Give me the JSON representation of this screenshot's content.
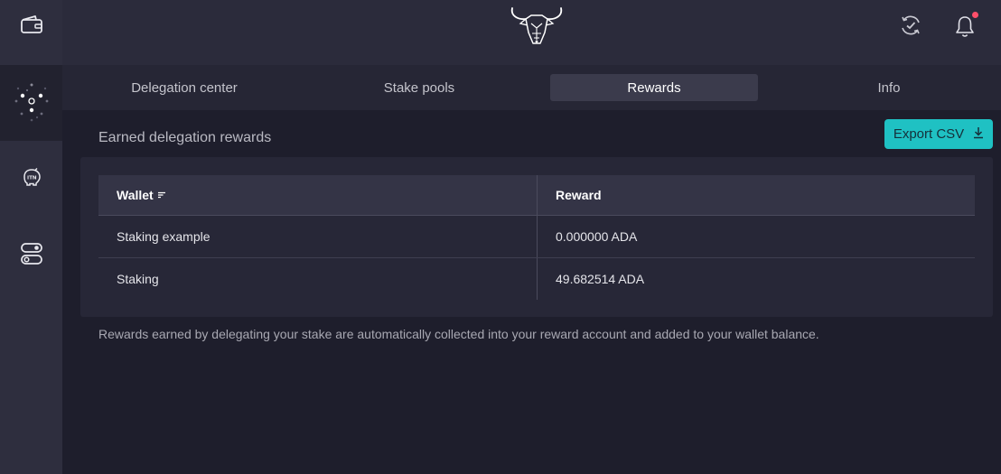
{
  "sidebar": {
    "items": [
      {
        "name": "wallet-icon",
        "active": false
      },
      {
        "name": "delegation-icon",
        "active": true
      },
      {
        "name": "itn-piggy-icon",
        "label": "ITN",
        "active": false
      },
      {
        "name": "settings-toggle-icon",
        "active": false
      }
    ]
  },
  "header": {
    "logo_icon": "daedalus-bull-logo",
    "sync_icon": "sync-check-icon",
    "notification_icon": "bell-icon",
    "notification_dot_color": "#ff4f6a"
  },
  "tabs": [
    {
      "label": "Delegation center",
      "active": false
    },
    {
      "label": "Stake pools",
      "active": false
    },
    {
      "label": "Rewards",
      "active": true
    },
    {
      "label": "Info",
      "active": false
    }
  ],
  "rewards": {
    "title": "Earned delegation rewards",
    "export_label": "Export CSV",
    "export_icon": "download-icon",
    "table": {
      "columns": [
        "Wallet",
        "Reward"
      ],
      "rows": [
        {
          "wallet": "Staking example",
          "reward": "0.000000 ADA"
        },
        {
          "wallet": "Staking",
          "reward": "49.682514 ADA"
        }
      ]
    },
    "note": "Rewards earned by delegating your stake are automatically collected into your reward account and added to your wallet balance."
  },
  "colors": {
    "accent": "#1fc1c3",
    "background": "#1e1e2c",
    "sidebar": "#2e2e3e"
  }
}
